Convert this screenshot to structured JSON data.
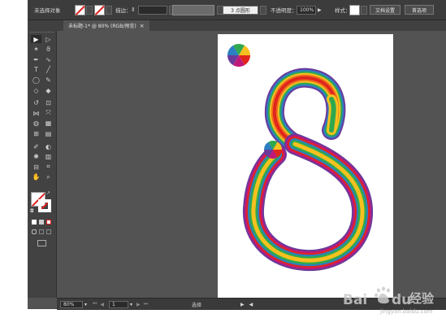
{
  "control_bar": {
    "selection_label": "未选择对象",
    "stroke_label": "描边：",
    "stroke_value": "",
    "brush_value": "3 点圆形",
    "opacity_label": "不透明度：",
    "opacity_value": "100%",
    "style_label": "样式：",
    "doc_setup_label": "文档设置",
    "preferences_label": "首选项"
  },
  "document_tab": {
    "title": "未标题-1* @ 80% (RGB/预览)",
    "close_glyph": "×"
  },
  "status_bar": {
    "zoom": "80%",
    "artboard_number": "1",
    "tool_label": "选择"
  },
  "watermark": {
    "text": "经验",
    "url": "jingyan.baidu.com"
  },
  "colors": {
    "app_bg": "#535353",
    "panel_bg": "#424242",
    "control_bg": "#3c3c3c",
    "artboard": "#ffffff",
    "rainbow": [
      "#e0261c",
      "#f0711e",
      "#f6c11f",
      "#2fa84f",
      "#2d7fc3",
      "#6a3a9a"
    ]
  },
  "tools": [
    "selection-tool",
    "direct-selection-tool",
    "magic-wand-tool",
    "lasso-tool",
    "pen-tool",
    "curvature-tool",
    "type-tool",
    "line-tool",
    "ellipse-tool",
    "brush-tool",
    "shaper-tool",
    "eraser-tool",
    "rotate-tool",
    "scale-tool",
    "width-tool",
    "free-transform-tool",
    "shape-builder-tool",
    "perspective-tool",
    "mesh-tool",
    "gradient-tool",
    "eyedropper-tool",
    "blend-tool",
    "symbol-sprayer-tool",
    "graph-tool",
    "artboard-tool",
    "slice-tool",
    "hand-tool",
    "zoom-tool"
  ]
}
